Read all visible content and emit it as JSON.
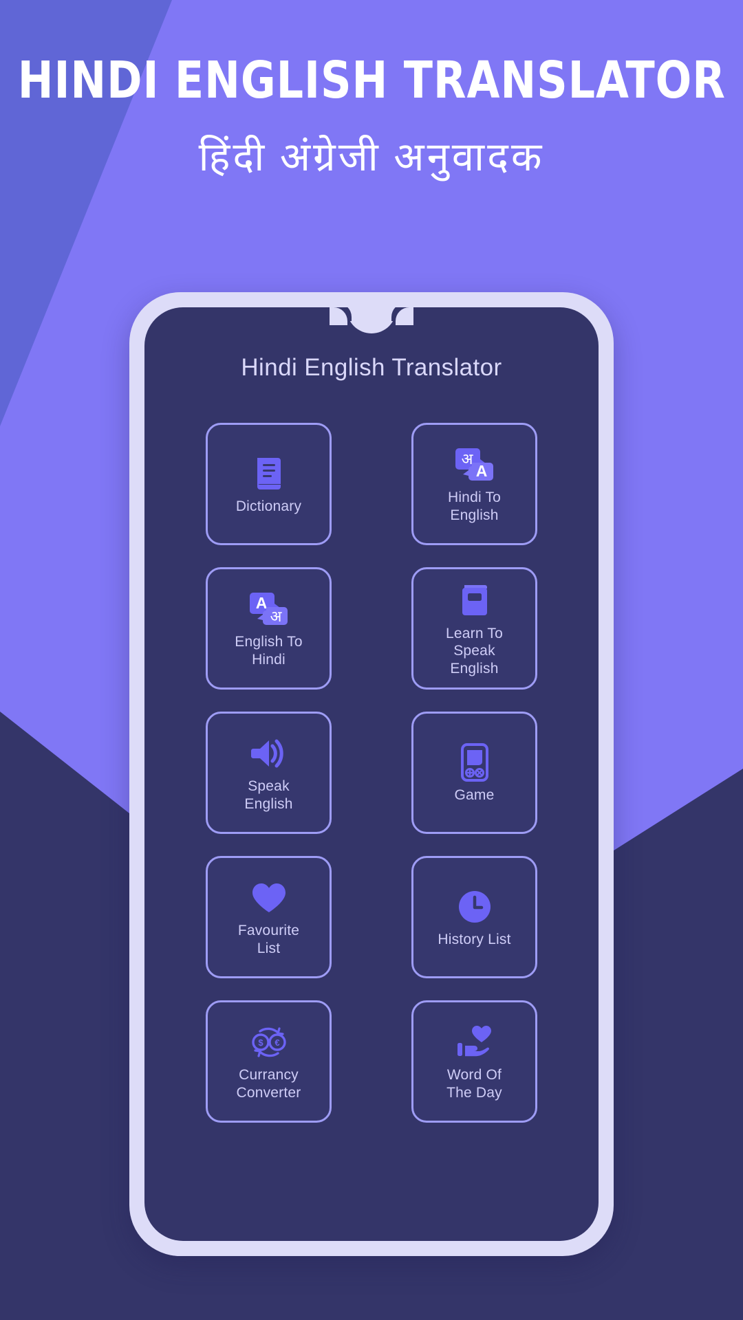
{
  "promo": {
    "title": "HINDI ENGLISH TRANSLATOR",
    "subtitle": "हिंदी  अंग्रेजी  अनुवादक"
  },
  "phone": {
    "app_title": "Hindi English Translator"
  },
  "colors": {
    "background_light": "#8077F5",
    "background_band": "#6066D6",
    "background_dark": "#343569",
    "phone_bezel": "#DDDCF8",
    "screen": "#343569",
    "tile_border": "#9E9CF5",
    "tile_fill": "#36376E",
    "icon_accent": "#6C63F5",
    "label_text": "#CFCDF7"
  },
  "tiles": [
    {
      "id": "dictionary",
      "label": "Dictionary",
      "icon": "book-icon"
    },
    {
      "id": "hindi-to-english",
      "label": "Hindi To\nEnglish",
      "icon": "translate-hindi-to-english-icon"
    },
    {
      "id": "english-to-hindi",
      "label": "English To\nHindi",
      "icon": "translate-english-to-hindi-icon"
    },
    {
      "id": "learn-to-speak",
      "label": "Learn To\nSpeak\nEnglish",
      "icon": "closed-book-icon"
    },
    {
      "id": "speak-english",
      "label": "Speak\nEnglish",
      "icon": "speaker-icon"
    },
    {
      "id": "game",
      "label": "Game",
      "icon": "handheld-console-icon"
    },
    {
      "id": "favourite-list",
      "label": "Favourite\nList",
      "icon": "heart-icon"
    },
    {
      "id": "history-list",
      "label": "History List",
      "icon": "clock-icon"
    },
    {
      "id": "currency-converter",
      "label": "Currancy\nConverter",
      "icon": "currency-exchange-icon"
    },
    {
      "id": "word-of-the-day",
      "label": "Word Of\nThe Day",
      "icon": "hand-heart-icon"
    }
  ]
}
